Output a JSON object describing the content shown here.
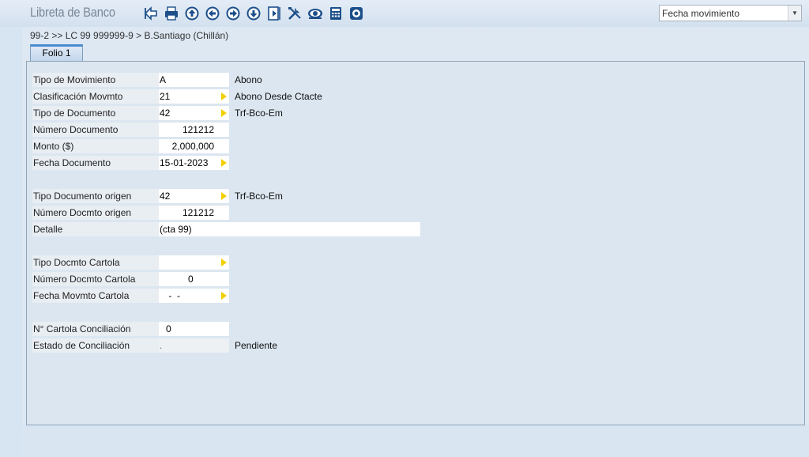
{
  "app": {
    "title": "Libreta de Banco"
  },
  "toolbar": {
    "buttons": [
      {
        "icon": "back-arrow-icon"
      },
      {
        "icon": "print-icon"
      },
      {
        "icon": "first-record-icon"
      },
      {
        "icon": "previous-record-icon"
      },
      {
        "icon": "next-record-icon"
      },
      {
        "icon": "last-record-icon"
      },
      {
        "icon": "export-icon"
      },
      {
        "icon": "tools-icon"
      },
      {
        "icon": "view-icon"
      },
      {
        "icon": "calculator-icon"
      },
      {
        "icon": "settings-icon"
      }
    ]
  },
  "sort": {
    "value": "Fecha movimiento"
  },
  "breadcrumb": "99-2 >> LC 99 999999-9 > B.Santiago  (Chillán)",
  "tabs": [
    {
      "label": "Folio 1"
    }
  ],
  "form": {
    "tipo_movimiento": {
      "label": "Tipo de Movimiento",
      "value": "A",
      "desc": "Abono"
    },
    "clasificacion": {
      "label": "Clasificación Movmto",
      "value": "21",
      "desc": "Abono Desde Ctacte"
    },
    "tipo_documento": {
      "label": "Tipo de Documento",
      "value": "42",
      "desc": "Trf-Bco-Em"
    },
    "numero_documento": {
      "label": "Número Documento",
      "value": "121212"
    },
    "monto": {
      "label": "Monto ($)",
      "value": "2,000,000"
    },
    "fecha_documento": {
      "label": "Fecha Documento",
      "value": "15-01-2023"
    },
    "tipo_doc_origen": {
      "label": "Tipo Documento origen",
      "value": "42",
      "desc": "Trf-Bco-Em"
    },
    "numero_doc_origen": {
      "label": "Número Docmto origen",
      "value": "121212"
    },
    "detalle": {
      "label": "Detalle",
      "value": "(cta 99)"
    },
    "tipo_doc_cartola": {
      "label": "Tipo Docmto Cartola",
      "value": ""
    },
    "numero_doc_cartola": {
      "label": "Número Docmto Cartola",
      "value": "0"
    },
    "fecha_mov_cartola": {
      "label": "Fecha Movmto Cartola",
      "value": " -  -"
    },
    "num_cartola_conc": {
      "label": "N° Cartola Conciliación",
      "value": "0"
    },
    "estado_conc": {
      "label": "Estado de Conciliación",
      "value": ".",
      "desc": "Pendiente"
    }
  }
}
